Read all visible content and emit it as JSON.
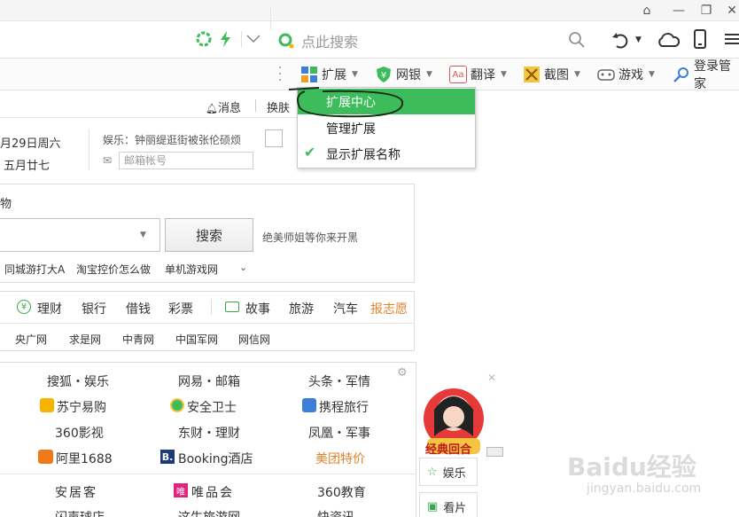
{
  "browser": {
    "search_placeholder": "点此搜索"
  },
  "toolbar": {
    "extensions_label": "扩展",
    "netbank_label": "网银",
    "translate_label": "翻译",
    "screenshot_label": "截图",
    "games_label": "游戏",
    "login_label": "登录管家"
  },
  "dropdown": {
    "items": [
      "扩展中心",
      "管理扩展",
      "显示扩展名称"
    ]
  },
  "page": {
    "message_label": "消息",
    "skin_label": "换肤",
    "date_line1": "月29日周六",
    "date_line2": "五月廿七",
    "news_headline": "娱乐：钟丽缇逛街被张伦硕烦",
    "mail_placeholder": "邮箱帐号",
    "search_tab": "物",
    "search_button": "搜索",
    "search_hint": "绝美师姐等你来开黑",
    "hot_searches": [
      "同城游打大A",
      "淘宝控价怎么做",
      "单机游戏网"
    ],
    "categories": [
      "理财",
      "银行",
      "借钱",
      "彩票",
      "故事",
      "旅游",
      "汽车",
      "报志愿"
    ],
    "media_links": [
      "央广网",
      "求是网",
      "中青网",
      "中国军网",
      "网信网"
    ],
    "sites": [
      [
        "搜狐・娱乐",
        "网易・邮箱",
        "头条・军情"
      ],
      [
        "苏宁易购",
        "安全卫士",
        "携程旅行"
      ],
      [
        "360影视",
        "东财・理财",
        "凤凰・军事"
      ],
      [
        "阿里1688",
        "Booking酒店",
        "美团特价"
      ],
      [
        "安居客",
        "唯品会",
        "360教育"
      ],
      [
        "闪声球店",
        "这生旅游网",
        "快资讯"
      ]
    ],
    "ad_title": "经典回合",
    "side_buttons": [
      "娱乐",
      "看片"
    ],
    "watermark": "Baidu经验",
    "watermark_url": "jingyan.baidu.com"
  },
  "colors": {
    "accent_green": "#3dbc5c",
    "link_orange": "#e0832a"
  }
}
